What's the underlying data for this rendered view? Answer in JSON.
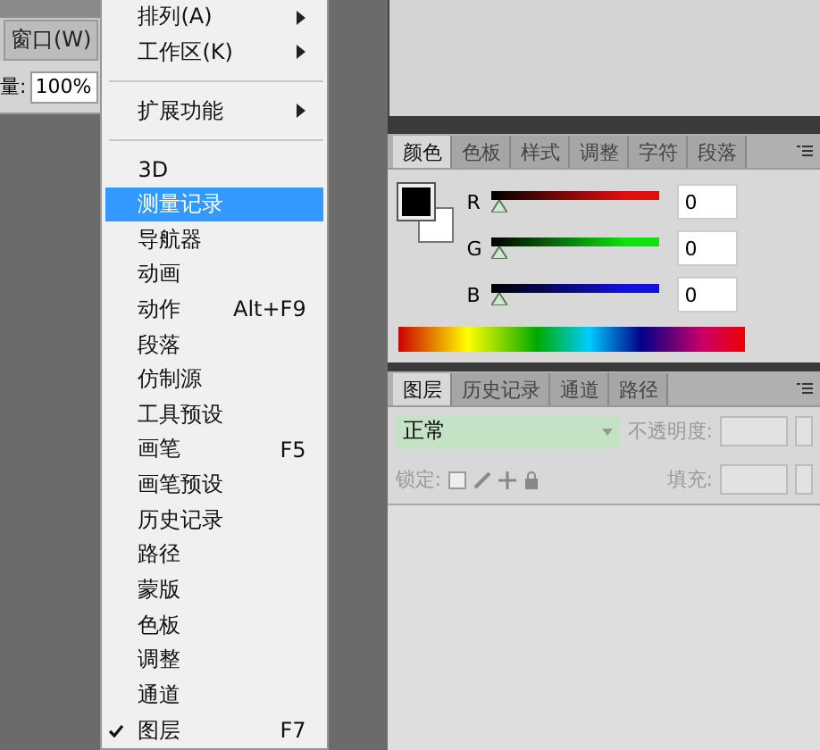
{
  "menubar": {
    "window_menu": "窗口(W)"
  },
  "options_bar": {
    "label": "量:",
    "zoom": "100%"
  },
  "menu": {
    "items": [
      {
        "kind": "item",
        "label": "排列(A)",
        "submenu": true,
        "selected": false,
        "checked": false
      },
      {
        "kind": "item",
        "label": "工作区(K)",
        "submenu": true,
        "selected": false,
        "checked": false
      },
      {
        "kind": "separator"
      },
      {
        "kind": "item",
        "label": "扩展功能",
        "submenu": true,
        "selected": false,
        "checked": false
      },
      {
        "kind": "separator"
      },
      {
        "kind": "item",
        "label": "3D",
        "selected": false,
        "checked": false
      },
      {
        "kind": "item",
        "label": "测量记录",
        "selected": true,
        "checked": false
      },
      {
        "kind": "item",
        "label": "导航器",
        "selected": false,
        "checked": false
      },
      {
        "kind": "item",
        "label": "动画",
        "selected": false,
        "checked": false
      },
      {
        "kind": "item",
        "label": "动作",
        "shortcut": "Alt+F9",
        "selected": false,
        "checked": false
      },
      {
        "kind": "item",
        "label": "段落",
        "selected": false,
        "checked": false
      },
      {
        "kind": "item",
        "label": "仿制源",
        "selected": false,
        "checked": false
      },
      {
        "kind": "item",
        "label": "工具预设",
        "selected": false,
        "checked": false
      },
      {
        "kind": "item",
        "label": "画笔",
        "shortcut": "F5",
        "selected": false,
        "checked": false
      },
      {
        "kind": "item",
        "label": "画笔预设",
        "selected": false,
        "checked": false
      },
      {
        "kind": "item",
        "label": "历史记录",
        "selected": false,
        "checked": false
      },
      {
        "kind": "item",
        "label": "路径",
        "selected": false,
        "checked": false
      },
      {
        "kind": "item",
        "label": "蒙版",
        "selected": false,
        "checked": false
      },
      {
        "kind": "item",
        "label": "色板",
        "selected": false,
        "checked": false
      },
      {
        "kind": "item",
        "label": "调整",
        "selected": false,
        "checked": false
      },
      {
        "kind": "item",
        "label": "通道",
        "selected": false,
        "checked": false
      },
      {
        "kind": "item",
        "label": "图层",
        "shortcut": "F7",
        "selected": false,
        "checked": true
      }
    ]
  },
  "color_panel": {
    "tabs": [
      {
        "label": "颜色",
        "selected": true
      },
      {
        "label": "色板",
        "selected": false
      },
      {
        "label": "样式",
        "selected": false
      },
      {
        "label": "调整",
        "selected": false
      },
      {
        "label": "字符",
        "selected": false
      },
      {
        "label": "段落",
        "selected": false
      }
    ],
    "channels": [
      {
        "name": "R",
        "color": "#e01010",
        "level": 0,
        "value": "0"
      },
      {
        "name": "G",
        "color": "#10e010",
        "level": 0,
        "value": "0"
      },
      {
        "name": "B",
        "color": "#1010e0",
        "level": 0,
        "value": "0"
      }
    ]
  },
  "layers_panel": {
    "tabs": [
      {
        "label": "图层",
        "selected": true
      },
      {
        "label": "历史记录",
        "selected": false
      },
      {
        "label": "通道",
        "selected": false
      },
      {
        "label": "路径",
        "selected": false
      }
    ],
    "blend_mode": "正常",
    "opacity_label": "不透明度:",
    "lock_label": "锁定:",
    "fill_label": "填充:"
  }
}
